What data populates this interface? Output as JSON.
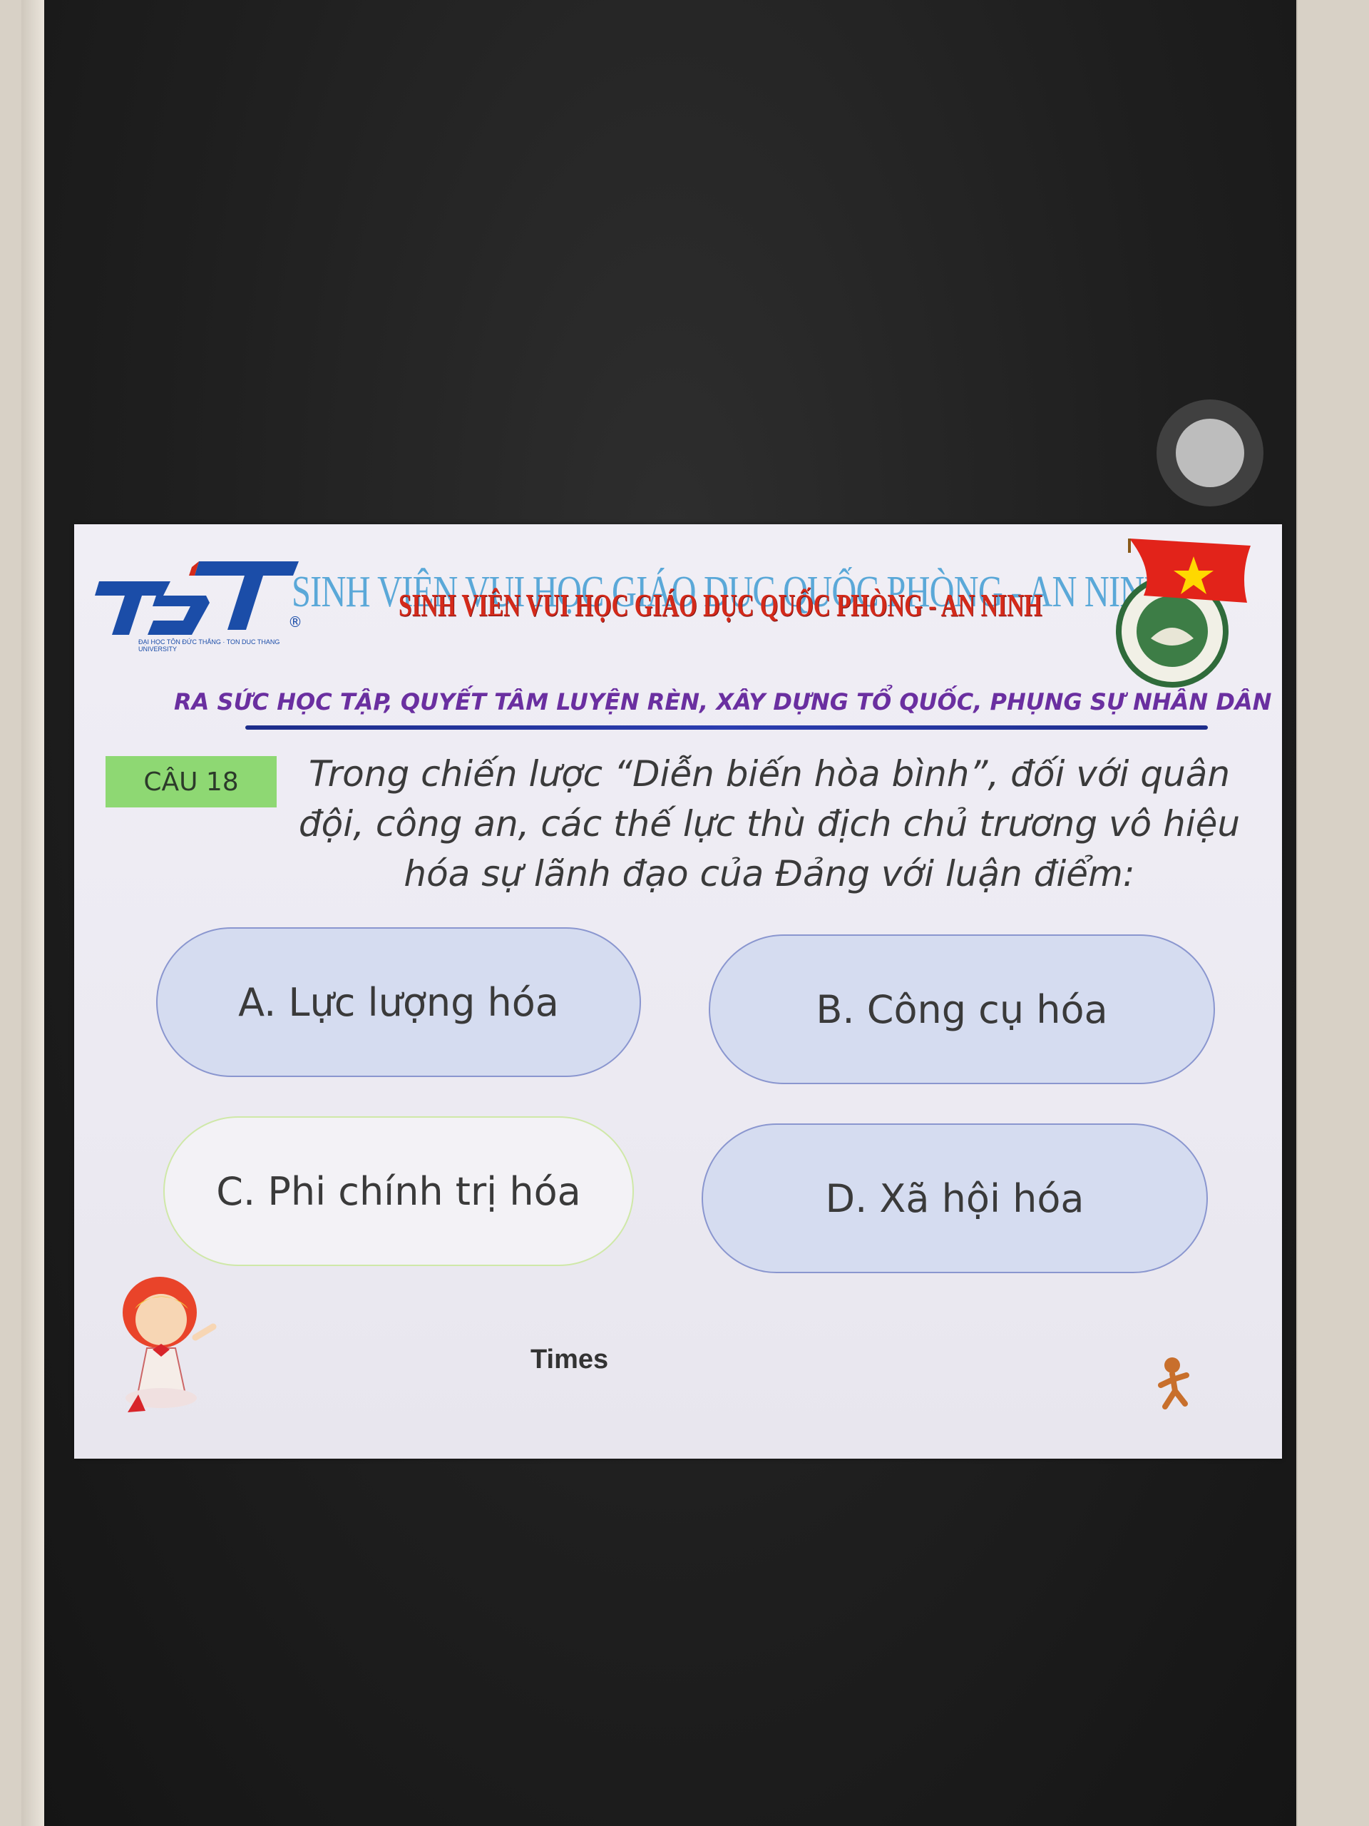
{
  "header": {
    "logo_text": "TĐT",
    "logo_subtext": "ĐẠI HỌC TÔN ĐỨC THẮNG · TON DUC THANG UNIVERSITY",
    "title_blue": "SINH VIÊN VUI HỌC GIÁO DỤC QUỐC PHÒNG - AN NINH",
    "title_red": "SINH VIÊN VUI HỌC GIÁO DỤC QUỐC PHÒNG - AN NINH",
    "slogan": "RA SỨC HỌC TẬP, QUYẾT TÂM LUYỆN RÈN, XÂY DỰNG TỔ QUỐC, PHỤNG SỰ NHÂN DÂN"
  },
  "question": {
    "label": "CÂU 18",
    "text": "Trong chiến lược “Diễn biến hòa bình”, đối với quân đội, công an, các thế lực thù địch chủ trương vô hiệu hóa sự lãnh đạo của Đảng với luận điểm:"
  },
  "options": {
    "a": "A. Lực lượng hóa",
    "b": "B. Công cụ hóa",
    "c": "C. Phi chính trị hóa",
    "d": "D. Xã hội hóa"
  },
  "footer": {
    "timer_label": "Times"
  },
  "colors": {
    "option_fill": "#d5dcf0",
    "option_border": "#8a96cf",
    "badge": "#8ed873",
    "slogan": "#6a2fa0",
    "title_red": "#d42a1a",
    "title_blue": "#5aa8d8"
  },
  "icons": {
    "assistive_touch": "assistive-touch-icon",
    "emblem": "youth-union-emblem-icon",
    "mascot": "girl-mascot-icon",
    "runner": "running-figure-icon"
  }
}
